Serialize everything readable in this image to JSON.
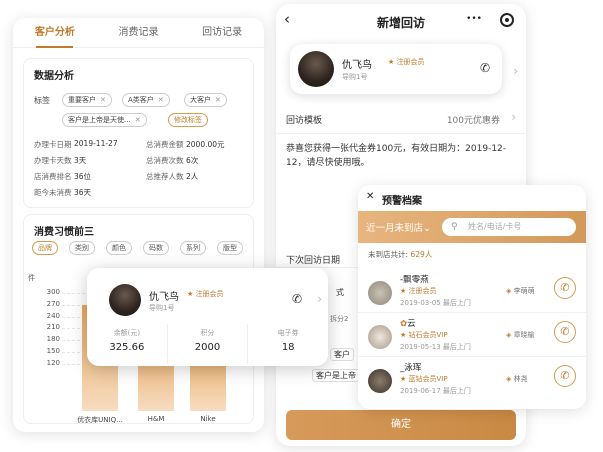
{
  "left": {
    "tabs": [
      "客户分析",
      "消费记录",
      "回访记录"
    ],
    "analysis_title": "数据分析",
    "tags_label": "标签",
    "tags": [
      "重要客户",
      "A类客户",
      "大客户",
      "客户是上帝是天使..."
    ],
    "edit_tags": "修改标签",
    "stats": [
      {
        "k": "办理卡日期",
        "v": "2019-11-27"
      },
      {
        "k": "总消费金额",
        "v": "2000.00元"
      },
      {
        "k": "办理卡天数",
        "v": "3天"
      },
      {
        "k": "总消费次数",
        "v": "6次"
      },
      {
        "k": "店消费排名",
        "v": "36位"
      },
      {
        "k": "总推荐人数",
        "v": "2人"
      },
      {
        "k": "距今未消费",
        "v": "36天"
      }
    ],
    "habits_title": "消费习惯前三",
    "filters": [
      "品牌",
      "类别",
      "颜色",
      "码数",
      "系列",
      "版型"
    ],
    "y_unit": "件"
  },
  "chart_data": {
    "type": "bar",
    "categories": [
      "优衣库UNIQ...",
      "H&M",
      "Nike"
    ],
    "values": [
      270,
      190,
      170
    ],
    "ylabel": "件",
    "ylim": [
      0,
      300
    ],
    "yticks": [
      "300",
      "270",
      "240",
      "210",
      "180",
      "150",
      "120"
    ]
  },
  "member_card": {
    "name": "仇飞鸟",
    "badge": "注册会员",
    "guide": "导购1号",
    "stats": [
      {
        "label": "余额(元)",
        "value": "325.66"
      },
      {
        "label": "积分",
        "value": "2000"
      },
      {
        "label": "电子券",
        "value": "18"
      }
    ]
  },
  "phone": {
    "title": "新增回访",
    "more": "•••",
    "customer": {
      "name": "仇飞鸟",
      "badge": "注册会员",
      "guide": "导购1号"
    },
    "template_label": "回访模板",
    "template_value": "100元优惠券",
    "message": "恭喜您获得一张代金券100元，有效日期为：2019-12-12，请尽快使用哦。",
    "next_date_label": "下次回访日期",
    "fragments": [
      "式",
      "拆分2",
      "客户",
      "客户是上帝"
    ],
    "confirm": "确定"
  },
  "popup": {
    "title": "预警档案",
    "filter": "近一月未到店",
    "search_placeholder": "姓名/电话/卡号",
    "count_label": "未到店共计:",
    "count_value": "629人",
    "people": [
      {
        "name": "-飘零燕",
        "badge": "注册会员",
        "guide": "李萌萌",
        "date": "2019-03-05",
        "last": "最后上门"
      },
      {
        "name": "云",
        "badge": "钻石会员VIP",
        "guide": "章晓榆",
        "date": "2019-05-13",
        "last": "最后上门"
      },
      {
        "name": "_泳珲",
        "badge": "蓝钻会员VIP",
        "guide": "林尧",
        "date": "2019-06-17",
        "last": "最后上门"
      }
    ]
  },
  "colors": {
    "accent": "#c17a2c",
    "bar": "#e9a861",
    "gold_light": "#f6dcc0"
  }
}
